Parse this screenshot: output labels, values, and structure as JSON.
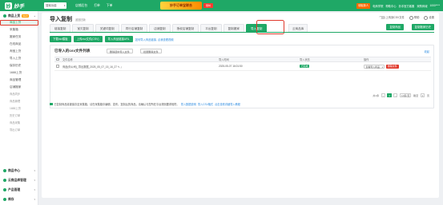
{
  "brand": {
    "logo_text": "妙手",
    "logo_glyph": "妙"
  },
  "topbar": {
    "store_select": "搜索功能",
    "nav": [
      "店铺后台",
      "打单",
      "下单"
    ],
    "promo": "妙手订单宝联合",
    "promo_tag": "限时",
    "right_items": [
      "领取新人",
      "电商学院",
      "帮助中心",
      "妙手官方客服",
      "采购商城",
      "1000****"
    ]
  },
  "sidebar": {
    "groups": [
      {
        "label": "商品上货",
        "badge": "NEW",
        "items": [
          "商品上货",
          "采集箱",
          "搬家任务",
          "在线商品",
          "淘宝上货",
          "导入上货",
          "保存历史",
          "1688上货",
          "商品管理",
          "店铺搬家",
          "商品同步",
          "商品管理",
          "1688上货",
          "历史订单",
          "商品采集",
          "导出订单"
        ]
      },
      {
        "label": "商品中心"
      },
      {
        "label": "云商品库管理"
      },
      {
        "label": "产品管理"
      },
      {
        "label": "库存"
      }
    ]
  },
  "header": {
    "title": "导入复制",
    "title_link": "返回旧版",
    "toggle_label": "上传到CSV文件",
    "help": "帮助",
    "settings": "设置"
  },
  "tabs": [
    "链接复制",
    "宝贝复制",
    "关键词复制",
    "同行店铺复制",
    "店铺复制",
    "授权店铺复制",
    "平台复制",
    "复制搬家",
    "导入复制"
  ],
  "tab_extra": "云商品库",
  "actions": {
    "start_copy": "复制商品",
    "history": "复制搬家历史"
  },
  "toolbar": {
    "download_template": "下载csv模板",
    "upload_csv": "上传csv文件(CSV)",
    "import_url": "导入商品链接URL",
    "help_link": "如何导入商品链接, 点我查看视频"
  },
  "section": {
    "title": "已导入的csv文件列表",
    "btn_delete_selected": "删除选中导入文件",
    "btn_batch_delete": "批量删除文件",
    "collapse": "收起"
  },
  "table": {
    "headers": [
      "文件名称",
      "导入时间",
      "导入状态",
      "操作"
    ],
    "rows": [
      {
        "name": "商品(你公司)_导出数据_2025_05_07_15_16_27 ✎ ⤓",
        "time": "2025-05-07 16:01:50",
        "status": "已完成",
        "action_select": "查看导入商品",
        "delete": "删除文件"
      }
    ]
  },
  "pager": {
    "total": "共1条",
    "page": "1",
    "size": "10条/页",
    "goto_label": "跳至",
    "goto_value": "1",
    "goto_suffix": "页"
  },
  "footnote": {
    "text": "已复制商品将被保存至采集箱，请在采集箱中编辑、发布。复制后的商品，请确认与您所在平台规则要求相符。",
    "link1": "导入数据说明",
    "link2": "导入CSV格式",
    "link3": "点击查看详细导入教程"
  },
  "colors": {
    "brand": "#1fa866",
    "alert": "#e0392c",
    "link": "#2a8ae0"
  }
}
